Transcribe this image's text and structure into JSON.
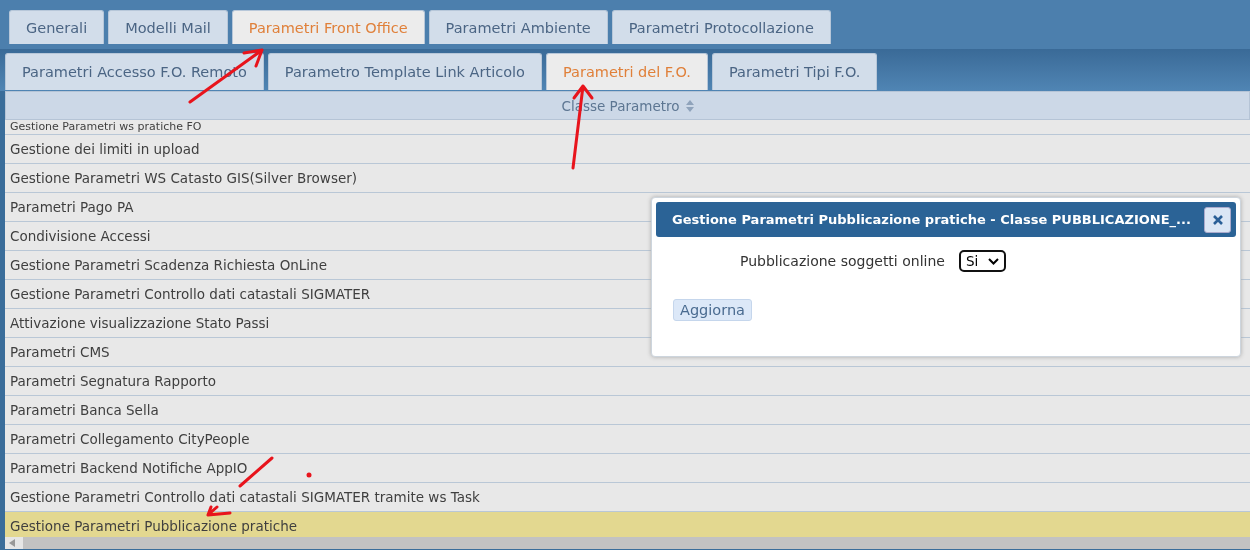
{
  "main_tabs": [
    {
      "label": "Generali",
      "selected": false
    },
    {
      "label": "Modelli Mail",
      "selected": false
    },
    {
      "label": "Parametri Front Office",
      "selected": true
    },
    {
      "label": "Parametri Ambiente",
      "selected": false
    },
    {
      "label": "Parametri Protocollazione",
      "selected": false
    }
  ],
  "sub_tabs": [
    {
      "label": "Parametri Accesso F.O. Remoto",
      "selected": false
    },
    {
      "label": "Parametro Template Link Articolo",
      "selected": false
    },
    {
      "label": "Parametri del F.O.",
      "selected": true
    },
    {
      "label": "Parametri Tipi F.O.",
      "selected": false
    }
  ],
  "table": {
    "columns": [
      {
        "label": "Classe Parametro"
      }
    ],
    "rows": [
      {
        "name": "Gestione Parametri ws pratiche FO",
        "selected": false
      },
      {
        "name": "Gestione dei limiti in upload",
        "selected": false
      },
      {
        "name": "Gestione Parametri WS Catasto GIS(Silver Browser)",
        "selected": false
      },
      {
        "name": "Parametri Pago PA",
        "selected": false
      },
      {
        "name": "Condivisione Accessi",
        "selected": false
      },
      {
        "name": "Gestione Parametri Scadenza Richiesta OnLine",
        "selected": false
      },
      {
        "name": "Gestione Parametri Controllo dati catastali SIGMATER",
        "selected": false
      },
      {
        "name": "Attivazione visualizzazione Stato Passi",
        "selected": false
      },
      {
        "name": "Parametri CMS",
        "selected": false
      },
      {
        "name": "Parametri Segnatura Rapporto",
        "selected": false
      },
      {
        "name": "Parametri Banca Sella",
        "selected": false
      },
      {
        "name": "Parametri Collegamento CityPeople",
        "selected": false
      },
      {
        "name": "Parametri Backend Notifiche AppIO",
        "selected": false
      },
      {
        "name": "Gestione Parametri Controllo dati catastali SIGMATER tramite ws Task",
        "selected": false
      },
      {
        "name": "Gestione Parametri Pubblicazione pratiche",
        "selected": true
      }
    ]
  },
  "dialog": {
    "title": "Gestione Parametri Pubblicazione pratiche - Classe PUBBLICAZIONE_...",
    "field_label": "Pubblicazione soggetti online",
    "field_value": "Si",
    "button": "Aggiorna"
  }
}
